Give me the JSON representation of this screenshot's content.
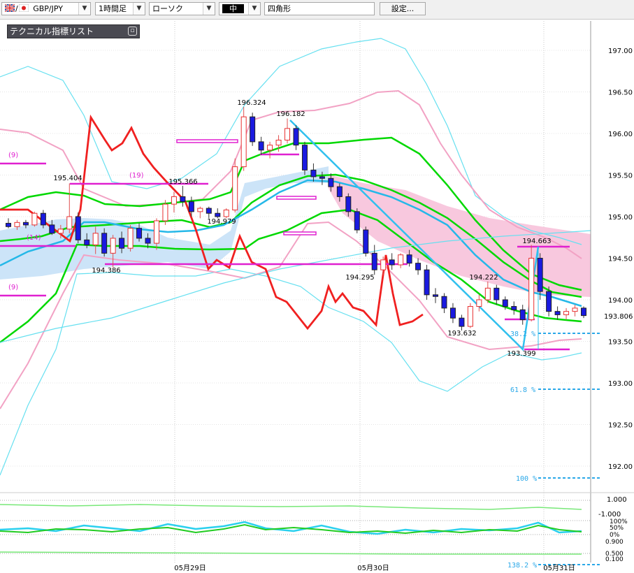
{
  "toolbar": {
    "symbol": "GBP/JPY",
    "timeframe": "1時間足",
    "chart_style": "ローソク",
    "line_width": "中",
    "drawing_tool": "四角形",
    "settings_label": "設定..."
  },
  "indicator_list": {
    "label": "テクニカル指標リスト"
  },
  "colors": {
    "up_candle": "#e83030",
    "down_candle": "#1a1ae0",
    "fast_line": "#00d800",
    "lag_line": "#f02020",
    "bollinger_outer": "#66e0f0",
    "bollinger_inner": "#f2a2c4",
    "cloud_blue": "#cce4f8",
    "cloud_pink": "#f8c8de",
    "level_line": "#e020d0"
  },
  "chart_data": {
    "type": "candlestick",
    "y_axis": {
      "min": 191.6,
      "max": 197.15,
      "ticks": [
        "197.00",
        "196.50",
        "196.00",
        "195.50",
        "195.00",
        "194.50",
        "194.00",
        "193.50",
        "193.00",
        "192.50",
        "192.00"
      ]
    },
    "current_price": "193.806",
    "date_labels": [
      "05月29日",
      "05月30日",
      "05月31日"
    ],
    "price_labels": [
      "196.324",
      "196.182",
      "195.404",
      "195.366",
      "194.979",
      "194.386",
      "194.295",
      "193.632",
      "194.222",
      "194.663",
      "193.399"
    ],
    "period_labels": [
      "(9)",
      "(19)",
      "(14)",
      "(9)"
    ],
    "fibonacci": [
      "38.2 %",
      "61.8 %",
      "100 %",
      "138.2 %"
    ],
    "oscillator_1": {
      "ticks": [
        "1.000",
        "-1.000"
      ]
    },
    "oscillator_2": {
      "ticks": [
        "100%",
        "50%",
        "0%",
        "0.900",
        "0.500",
        "0.100"
      ]
    },
    "candles": [
      [
        194.92,
        194.98,
        194.86,
        194.88
      ],
      [
        194.88,
        194.96,
        194.84,
        194.93
      ],
      [
        194.93,
        194.96,
        194.86,
        194.9
      ],
      [
        194.9,
        195.06,
        194.88,
        195.04
      ],
      [
        195.04,
        195.08,
        194.86,
        194.9
      ],
      [
        194.9,
        194.96,
        194.78,
        194.8
      ],
      [
        194.8,
        194.9,
        194.74,
        194.85
      ],
      [
        194.85,
        195.4,
        194.8,
        195.0
      ],
      [
        195.0,
        195.05,
        194.68,
        194.72
      ],
      [
        194.72,
        194.8,
        194.62,
        194.66
      ],
      [
        194.66,
        194.88,
        194.55,
        194.8
      ],
      [
        194.8,
        194.86,
        194.52,
        194.56
      ],
      [
        194.56,
        194.78,
        194.39,
        194.74
      ],
      [
        194.74,
        194.82,
        194.56,
        194.62
      ],
      [
        194.62,
        194.9,
        194.58,
        194.86
      ],
      [
        194.86,
        194.92,
        194.7,
        194.74
      ],
      [
        194.74,
        194.8,
        194.62,
        194.68
      ],
      [
        194.68,
        194.98,
        194.6,
        194.95
      ],
      [
        194.95,
        195.2,
        194.9,
        195.15
      ],
      [
        195.15,
        195.3,
        195.05,
        195.24
      ],
      [
        195.24,
        195.37,
        195.12,
        195.18
      ],
      [
        195.18,
        195.24,
        195.0,
        195.06
      ],
      [
        195.06,
        195.12,
        194.98,
        195.1
      ],
      [
        195.1,
        195.12,
        194.98,
        195.04
      ],
      [
        195.04,
        195.1,
        194.98,
        195.0
      ],
      [
        195.0,
        195.1,
        194.98,
        195.08
      ],
      [
        195.08,
        195.7,
        195.05,
        195.6
      ],
      [
        195.6,
        196.32,
        195.55,
        196.2
      ],
      [
        196.2,
        196.25,
        195.85,
        195.9
      ],
      [
        195.9,
        195.96,
        195.74,
        195.8
      ],
      [
        195.8,
        195.9,
        195.7,
        195.86
      ],
      [
        195.86,
        195.98,
        195.78,
        195.92
      ],
      [
        195.92,
        196.18,
        195.88,
        196.06
      ],
      [
        196.06,
        196.1,
        195.8,
        195.86
      ],
      [
        195.86,
        195.9,
        195.5,
        195.56
      ],
      [
        195.56,
        195.64,
        195.42,
        195.48
      ],
      [
        195.48,
        195.54,
        195.38,
        195.46
      ],
      [
        195.46,
        195.52,
        195.3,
        195.36
      ],
      [
        195.36,
        195.4,
        195.18,
        195.24
      ],
      [
        195.24,
        195.28,
        195.0,
        195.06
      ],
      [
        195.06,
        195.1,
        194.8,
        194.84
      ],
      [
        194.84,
        194.88,
        194.52,
        194.56
      ],
      [
        194.56,
        194.66,
        194.3,
        194.36
      ],
      [
        194.36,
        194.52,
        194.3,
        194.48
      ],
      [
        194.48,
        194.56,
        194.36,
        194.42
      ],
      [
        194.42,
        194.56,
        194.38,
        194.54
      ],
      [
        194.54,
        194.6,
        194.4,
        194.44
      ],
      [
        194.44,
        194.5,
        194.3,
        194.36
      ],
      [
        194.36,
        194.42,
        194.0,
        194.06
      ],
      [
        194.06,
        194.14,
        193.96,
        194.04
      ],
      [
        194.04,
        194.08,
        193.84,
        193.9
      ],
      [
        193.9,
        193.96,
        193.72,
        193.78
      ],
      [
        193.78,
        193.82,
        193.63,
        193.68
      ],
      [
        193.68,
        193.96,
        193.66,
        193.92
      ],
      [
        193.92,
        194.06,
        193.86,
        194.0
      ],
      [
        194.0,
        194.22,
        193.96,
        194.14
      ],
      [
        194.14,
        194.18,
        193.94,
        194.0
      ],
      [
        194.0,
        194.04,
        193.88,
        193.92
      ],
      [
        193.92,
        193.98,
        193.82,
        193.88
      ],
      [
        193.88,
        193.94,
        193.7,
        193.76
      ],
      [
        193.76,
        194.66,
        193.74,
        194.5
      ],
      [
        194.5,
        194.56,
        194.0,
        194.1
      ],
      [
        194.1,
        194.16,
        193.8,
        193.86
      ],
      [
        193.86,
        193.92,
        193.76,
        193.82
      ],
      [
        193.82,
        193.9,
        193.76,
        193.86
      ],
      [
        193.86,
        193.94,
        193.8,
        193.9
      ],
      [
        193.9,
        193.92,
        193.78,
        193.81
      ]
    ]
  }
}
